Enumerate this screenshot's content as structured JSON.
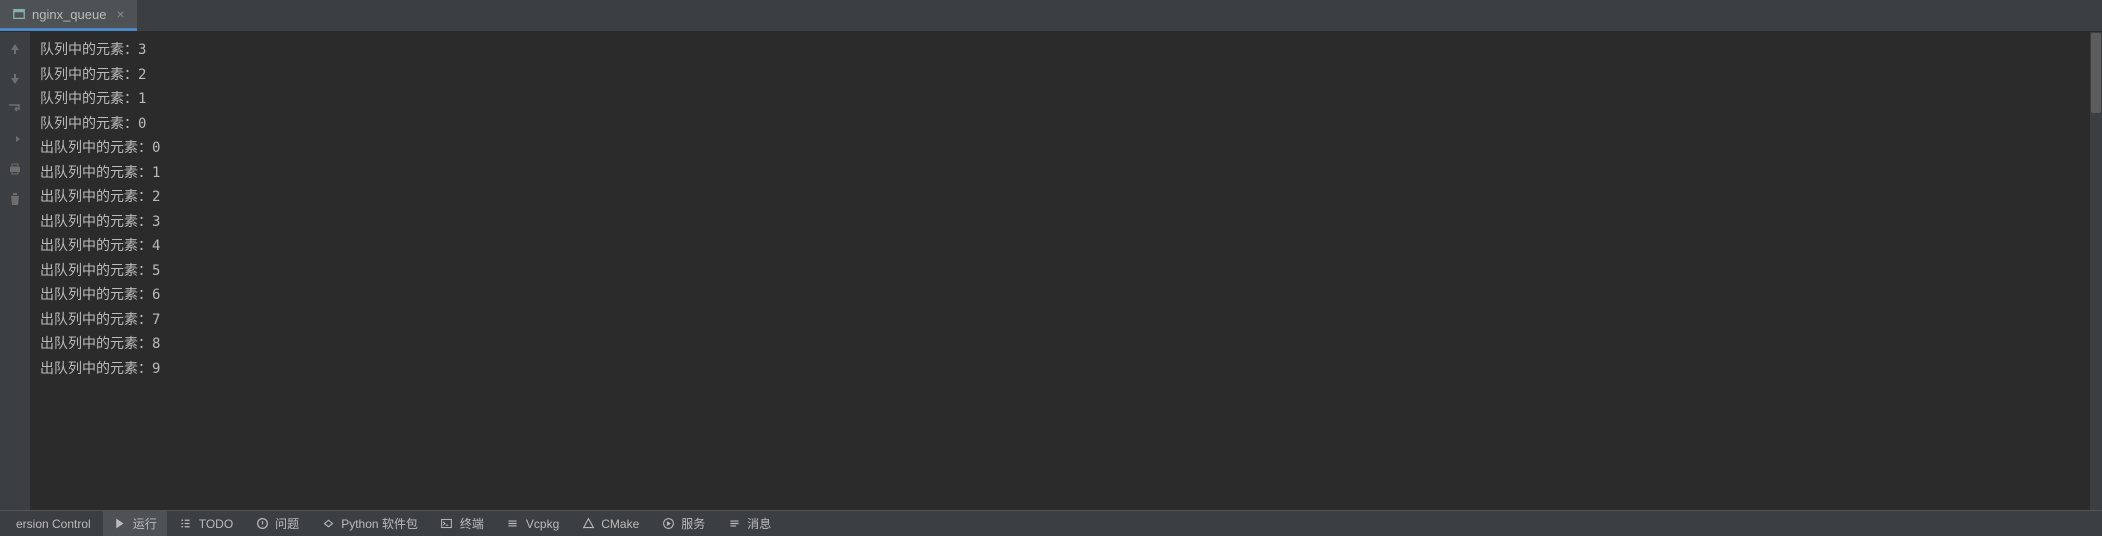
{
  "tab": {
    "label": "nginx_queue",
    "close": "×"
  },
  "console": {
    "lines": [
      "队列中的元素：3",
      "队列中的元素：2",
      "队列中的元素：1",
      "队列中的元素：0",
      "出队列中的元素：0",
      "出队列中的元素：1",
      "出队列中的元素：2",
      "出队列中的元素：3",
      "出队列中的元素：4",
      "出队列中的元素：5",
      "出队列中的元素：6",
      "出队列中的元素：7",
      "出队列中的元素：8",
      "出队列中的元素：9"
    ]
  },
  "bottomBar": {
    "versionControl": "ersion Control",
    "run": "运行",
    "todo": "TODO",
    "problems": "问题",
    "python": "Python 软件包",
    "terminal": "终端",
    "vcpkg": "Vcpkg",
    "cmake": "CMake",
    "services": "服务",
    "messages": "消息"
  }
}
